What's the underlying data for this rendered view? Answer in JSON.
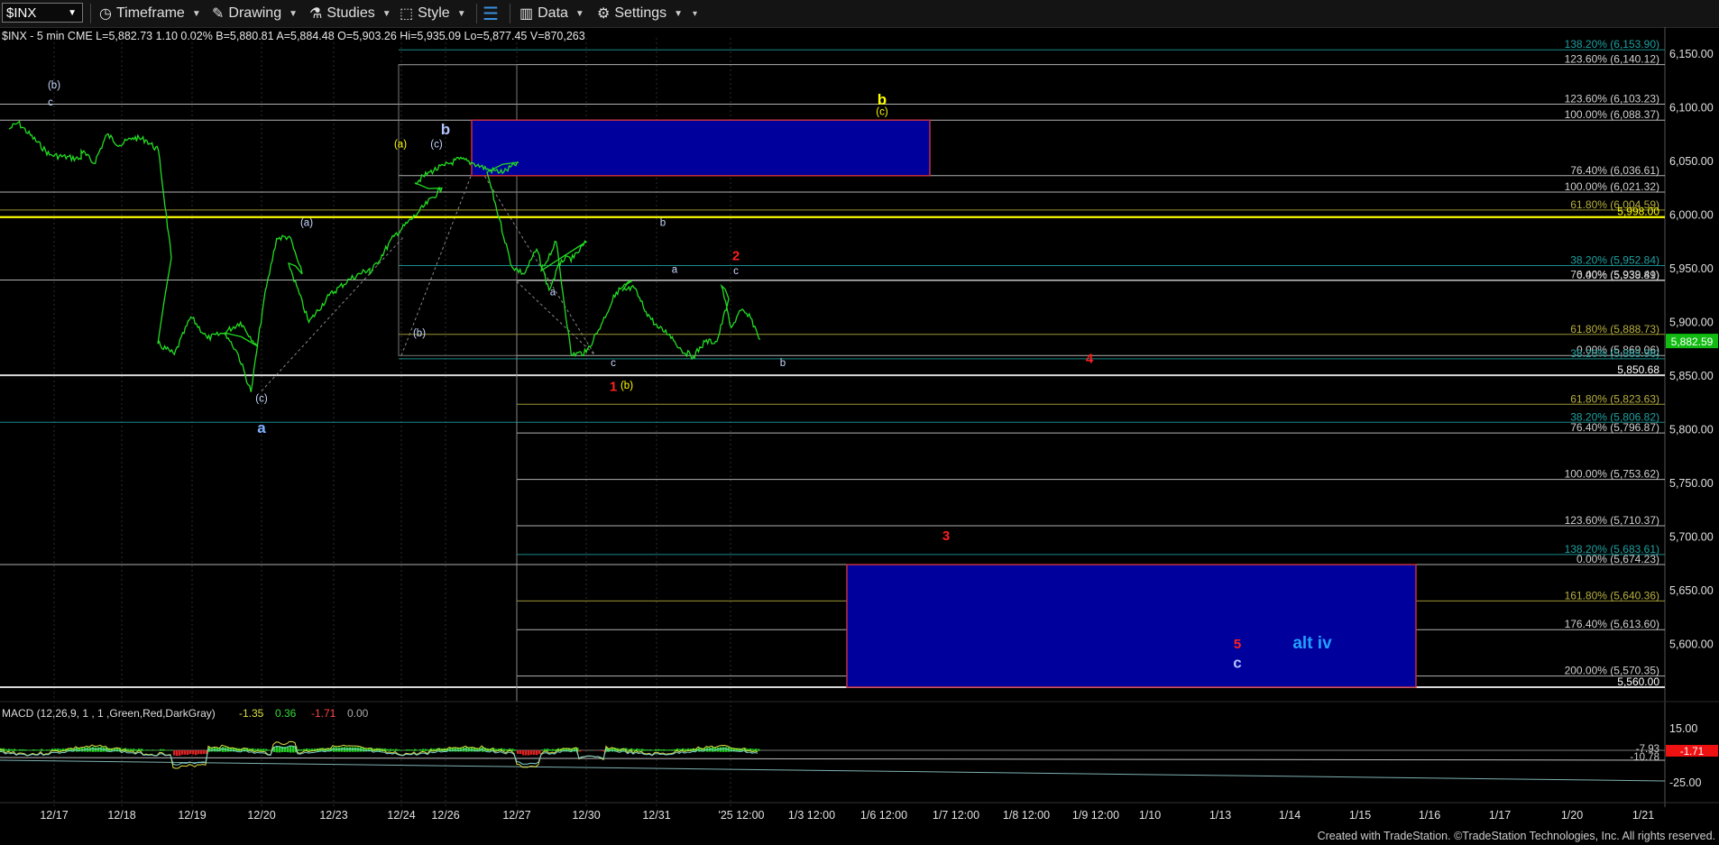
{
  "toolbar": {
    "symbol": "$INX",
    "timeframe": "Timeframe",
    "drawing": "Drawing",
    "studies": "Studies",
    "style": "Style",
    "data": "Data",
    "settings": "Settings"
  },
  "info_line": "$INX - 5 min  CME   L=5,882.73  1.10   0.02%   B=5,880.81  A=5,884.48   O=5,903.26  Hi=5,935.09  Lo=5,877.45   V=870,263",
  "footer": "Created with TradeStation. ©TradeStation Technologies, Inc. All rights reserved.",
  "colors": {
    "price": "#22dd22",
    "yellow": "#ffff00",
    "blue_box": "#00009c",
    "red": "#ff2020",
    "grey_line": "#9a9a9a"
  },
  "chart_data": {
    "type": "line",
    "title": "",
    "symbol": "$INX",
    "interval": "5 min",
    "ylim": [
      5560,
      6165
    ],
    "y_ticks": [
      6150,
      6100,
      6050,
      6000,
      5950,
      5900,
      5850,
      5800,
      5750,
      5700,
      5650,
      5600
    ],
    "y_tick_labels": [
      "6,150.00",
      "6,100.00",
      "6,050.00",
      "6,000.00",
      "5,950.00",
      "5,900.00",
      "5,850.00",
      "5,800.00",
      "5,750.00",
      "5,700.00",
      "5,650.00",
      "5,600.00"
    ],
    "last_price_label": "5,882.59",
    "x_tick_labels": [
      "12/17",
      "12/18",
      "12/19",
      "12/20",
      "12/23",
      "12/24",
      "12/26",
      "12/27",
      "12/30",
      "12/31",
      "'25 12:00",
      "1/3 12:00",
      "1/6 12:00",
      "1/7 12:00",
      "1/8 12:00",
      "1/9 12:00",
      "1/10",
      "1/13",
      "1/14",
      "1/15",
      "1/16",
      "1/17",
      "1/20",
      "1/21"
    ],
    "price_series": {
      "name": "$INX",
      "points": [
        [
          "12/16",
          6080
        ],
        [
          "12/17",
          6086
        ],
        [
          "12/17",
          6056
        ],
        [
          "12/17",
          6052
        ],
        [
          "12/18",
          6060
        ],
        [
          "12/18",
          6048
        ],
        [
          "12/18",
          6075
        ],
        [
          "12/18",
          6065
        ],
        [
          "12/18",
          6072
        ],
        [
          "12/18",
          6070
        ],
        [
          "12/18",
          6060
        ],
        [
          "12/18",
          5960
        ],
        [
          "12/19",
          5880
        ],
        [
          "12/19",
          5870
        ],
        [
          "12/19",
          5905
        ],
        [
          "12/19",
          5885
        ],
        [
          "12/19",
          5890
        ],
        [
          "12/19",
          5900
        ],
        [
          "12/19",
          5878
        ],
        [
          "12/20",
          5890
        ],
        [
          "12/20",
          5870
        ],
        [
          "12/20",
          5835
        ],
        [
          "12/20",
          5920
        ],
        [
          "12/20",
          5978
        ],
        [
          "12/20",
          5980
        ],
        [
          "12/20",
          5945
        ],
        [
          "12/23",
          5955
        ],
        [
          "12/23",
          5900
        ],
        [
          "12/23",
          5925
        ],
        [
          "12/23",
          5940
        ],
        [
          "12/23",
          5950
        ],
        [
          "12/24",
          5945
        ],
        [
          "12/24",
          5980
        ],
        [
          "12/24",
          6002
        ],
        [
          "12/24",
          6025
        ],
        [
          "12/26",
          6030
        ],
        [
          "12/26",
          6040
        ],
        [
          "12/26",
          6046
        ],
        [
          "12/26",
          6052
        ],
        [
          "12/26",
          6048
        ],
        [
          "12/26",
          6042
        ],
        [
          "12/26",
          6040
        ],
        [
          "12/26",
          6049
        ],
        [
          "12/27",
          6040
        ],
        [
          "12/27",
          5996
        ],
        [
          "12/27",
          5952
        ],
        [
          "12/27",
          5945
        ],
        [
          "12/27",
          5968
        ],
        [
          "12/27",
          5930
        ],
        [
          "12/27",
          5958
        ],
        [
          "12/27",
          5960
        ],
        [
          "12/27",
          5975
        ],
        [
          "12/30",
          5948
        ],
        [
          "12/30",
          5975
        ],
        [
          "12/30",
          5870
        ],
        [
          "12/30",
          5872
        ],
        [
          "12/30",
          5898
        ],
        [
          "12/30",
          5928
        ],
        [
          "12/30",
          5938
        ],
        [
          "12/31",
          5929
        ],
        [
          "12/31",
          5932
        ],
        [
          "12/31",
          5910
        ],
        [
          "12/31",
          5895
        ],
        [
          "12/31",
          5889
        ],
        [
          "12/31",
          5874
        ],
        [
          "12/31",
          5868
        ],
        [
          "12/31",
          5882
        ],
        [
          "12/31",
          5882
        ],
        [
          "12/31",
          5922
        ],
        [
          "'25 12:00",
          5934
        ],
        [
          "'25 12:00",
          5895
        ],
        [
          "'25 12:00",
          5911
        ],
        [
          "'25 12:00",
          5904
        ],
        [
          "'25 12:00",
          5884
        ]
      ]
    },
    "horizontal_levels": [
      {
        "label": "138.20% (6,153.90)",
        "value": 6153.9,
        "color": "#20a0a0"
      },
      {
        "label": "123.60% (6,140.12)",
        "value": 6140.12,
        "color": "#d0d0d0"
      },
      {
        "label": "123.60% (6,103.23)",
        "value": 6103.23,
        "color": "#d0d0d0"
      },
      {
        "label": "100.00% (6,088.37)",
        "value": 6088.37,
        "color": "#d0d0d0"
      },
      {
        "label": "76.40% (6,036.61)",
        "value": 6036.61,
        "color": "#d0d0d0"
      },
      {
        "label": "100.00% (6,021.32)",
        "value": 6021.32,
        "color": "#d0d0d0"
      },
      {
        "label": "61.80% (6,004.59)",
        "value": 6004.59,
        "color": "#b8b040"
      },
      {
        "label": "5,998.00",
        "value": 5998,
        "color": "#ffff00"
      },
      {
        "label": "38.20% (5,952.84)",
        "value": 5952.84,
        "color": "#20a0a0"
      },
      {
        "label": "76.40% (5,939.41)",
        "value": 5939.41,
        "color": "#d0d0d0"
      },
      {
        "label": "0.00% (5,938.89)",
        "value": 5938.89,
        "color": "#d0d0d0"
      },
      {
        "label": "61.80% (5,888.73)",
        "value": 5888.73,
        "color": "#b8b040"
      },
      {
        "label": "0.00% (5,869.06)",
        "value": 5869.06,
        "color": "#d0d0d0"
      },
      {
        "label": "38.20% (5,865.96)",
        "value": 5865.96,
        "color": "#20a0a0"
      },
      {
        "label": "5,850.68",
        "value": 5850.68,
        "color": "#ffffff"
      },
      {
        "label": "61.80% (5,823.63)",
        "value": 5823.63,
        "color": "#b8b040"
      },
      {
        "label": "38.20% (5,806.82)",
        "value": 5806.82,
        "color": "#20a0a0"
      },
      {
        "label": "76.40% (5,796.87)",
        "value": 5796.87,
        "color": "#d0d0d0"
      },
      {
        "label": "100.00% (5,753.62)",
        "value": 5753.62,
        "color": "#d0d0d0"
      },
      {
        "label": "123.60% (5,710.37)",
        "value": 5710.37,
        "color": "#d0d0d0"
      },
      {
        "label": "138.20% (5,683.61)",
        "value": 5683.61,
        "color": "#20a0a0"
      },
      {
        "label": "0.00% (5,674.23)",
        "value": 5674.23,
        "color": "#d0d0d0"
      },
      {
        "label": "161.80% (5,640.36)",
        "value": 5640.36,
        "color": "#b8b040"
      },
      {
        "label": "176.40% (5,613.60)",
        "value": 5613.6,
        "color": "#d0d0d0"
      },
      {
        "label": "200.00% (5,570.35)",
        "value": 5570.35,
        "color": "#d0d0d0"
      },
      {
        "label": "5,560.00",
        "value": 5560,
        "color": "#ffffff"
      }
    ],
    "target_boxes": [
      {
        "name": "b-target-box",
        "x_from": "12/26",
        "x_to": "1/7",
        "y_from": 6036.61,
        "y_to": 6088.37
      },
      {
        "name": "c-target-box",
        "x_from": "1/3",
        "x_to": "1/16",
        "y_from": 5560,
        "y_to": 5674.23
      }
    ],
    "wave_labels": [
      {
        "text": "(b)",
        "x": "12/17",
        "y": 6118,
        "color": "#c8d8ff"
      },
      {
        "text": "c",
        "x": "12/17",
        "y": 6102,
        "color": "#c8d8ff"
      },
      {
        "text": "(a)",
        "x": "12/20",
        "y": 5990,
        "color": "#c8d8ff"
      },
      {
        "text": "(b)",
        "x": "12/23",
        "y": 5887,
        "color": "#c8d8ff"
      },
      {
        "text": "(c)",
        "x": "12/20",
        "y": 5826,
        "color": "#c8d8ff"
      },
      {
        "text": "a",
        "x": "12/20",
        "y": 5797,
        "color": "#7fb0ff"
      },
      {
        "text": "(a)",
        "x": "12/26",
        "y": 6063,
        "color": "#ffff00"
      },
      {
        "text": "b",
        "x": "12/26",
        "y": 6075,
        "color": "#b0c4ff"
      },
      {
        "text": "(c)",
        "x": "12/26",
        "y": 6063,
        "color": "#c8d8ff"
      },
      {
        "text": "b",
        "x": "1/6",
        "y": 6103,
        "color": "#ffff00"
      },
      {
        "text": "(c)",
        "x": "1/6",
        "y": 6093,
        "color": "#ffff00"
      },
      {
        "text": "b",
        "x": "12/30",
        "y": 5990,
        "color": "#c8d8ff"
      },
      {
        "text": "a",
        "x": "12/27",
        "y": 5925,
        "color": "#c8d8ff"
      },
      {
        "text": "c",
        "x": "12/30",
        "y": 5859,
        "color": "#c8d8ff"
      },
      {
        "text": "1",
        "x": "12/30",
        "y": 5836,
        "color": "#ff2020"
      },
      {
        "text": "(b)",
        "x": "12/30",
        "y": 5838,
        "color": "#ffff00"
      },
      {
        "text": "a",
        "x": "12/31",
        "y": 5946,
        "color": "#c8d8ff"
      },
      {
        "text": "b",
        "x": "12/31",
        "y": 5859,
        "color": "#c8d8ff"
      },
      {
        "text": "2",
        "x": "'25 12:00",
        "y": 5958,
        "color": "#ff2020"
      },
      {
        "text": "c",
        "x": "'25 12:00",
        "y": 5945,
        "color": "#c8d8ff"
      },
      {
        "text": "4",
        "x": "1/9",
        "y": 5862,
        "color": "#ff2020"
      },
      {
        "text": "3",
        "x": "1/7",
        "y": 5697,
        "color": "#ff2020"
      },
      {
        "text": "5",
        "x": "1/13",
        "y": 5596,
        "color": "#ff2020"
      },
      {
        "text": "c",
        "x": "1/13",
        "y": 5578,
        "color": "#b0c4ff"
      },
      {
        "text": "alt iv",
        "x": "1/14",
        "y": 5596,
        "color": "#22a0ff"
      }
    ],
    "macd": {
      "label": "MACD (12,26,9, 1 , 1 ,Green,Red,DarkGray)",
      "values_text": [
        "-1.35",
        "0.36",
        "-1.71",
        "0.00"
      ],
      "y_tick_labels": [
        "15.00",
        "-25.00"
      ],
      "right_labels": [
        "-7.93",
        "-10.78",
        "-1.71"
      ]
    }
  }
}
